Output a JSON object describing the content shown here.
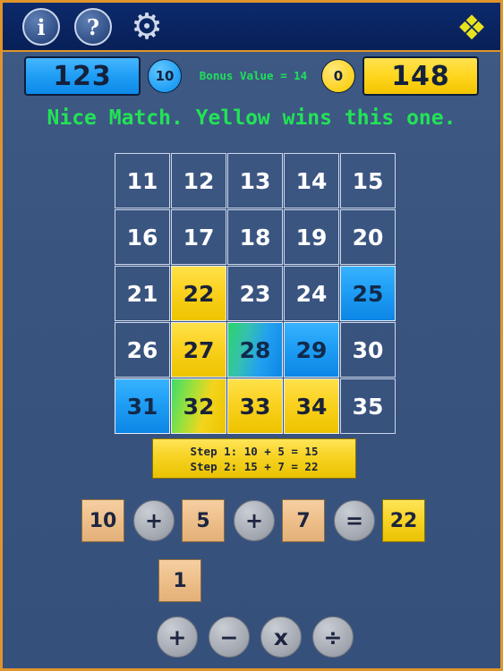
{
  "topbar": {
    "info_label": "i",
    "help_label": "?",
    "settings_icon": "gear-icon",
    "settings_glyph": "⚙",
    "puzzle_icon": "puzzle-piece-icon",
    "puzzle_glyph": "❖"
  },
  "scores": {
    "blue_score": "123",
    "blue_pill": "10",
    "bonus_text": "Bonus Value = 14",
    "yellow_pill": "0",
    "yellow_score": "148"
  },
  "message": "Nice Match. Yellow wins this one.",
  "grid": {
    "cells": [
      {
        "value": "11",
        "state": "plain"
      },
      {
        "value": "12",
        "state": "plain"
      },
      {
        "value": "13",
        "state": "plain"
      },
      {
        "value": "14",
        "state": "plain"
      },
      {
        "value": "15",
        "state": "plain"
      },
      {
        "value": "16",
        "state": "plain"
      },
      {
        "value": "17",
        "state": "plain"
      },
      {
        "value": "18",
        "state": "plain"
      },
      {
        "value": "19",
        "state": "plain"
      },
      {
        "value": "20",
        "state": "plain"
      },
      {
        "value": "21",
        "state": "plain"
      },
      {
        "value": "22",
        "state": "yellow"
      },
      {
        "value": "23",
        "state": "plain"
      },
      {
        "value": "24",
        "state": "plain"
      },
      {
        "value": "25",
        "state": "blue"
      },
      {
        "value": "26",
        "state": "plain"
      },
      {
        "value": "27",
        "state": "yellow"
      },
      {
        "value": "28",
        "state": "bluegreen"
      },
      {
        "value": "29",
        "state": "blue"
      },
      {
        "value": "30",
        "state": "plain"
      },
      {
        "value": "31",
        "state": "blue"
      },
      {
        "value": "32",
        "state": "yellowgreen"
      },
      {
        "value": "33",
        "state": "yellow"
      },
      {
        "value": "34",
        "state": "yellow"
      },
      {
        "value": "35",
        "state": "plain"
      }
    ]
  },
  "steps": {
    "line1": "Step 1:  10 + 5 = 15",
    "line2": "Step 2:  15 + 7 = 22"
  },
  "equation": {
    "t1": "10",
    "op1": "+",
    "t2": "5",
    "op2": "+",
    "t3": "7",
    "op3": "=",
    "result": "22"
  },
  "hand": {
    "tile1": "1"
  },
  "operators": {
    "plus": "+",
    "minus": "−",
    "times": "x",
    "divide": "÷"
  },
  "colors": {
    "blue": "#1f9ef5",
    "yellow": "#f9d01c",
    "green_text": "#22e356",
    "accent_border": "#e0952c",
    "background": "#3a5480"
  }
}
